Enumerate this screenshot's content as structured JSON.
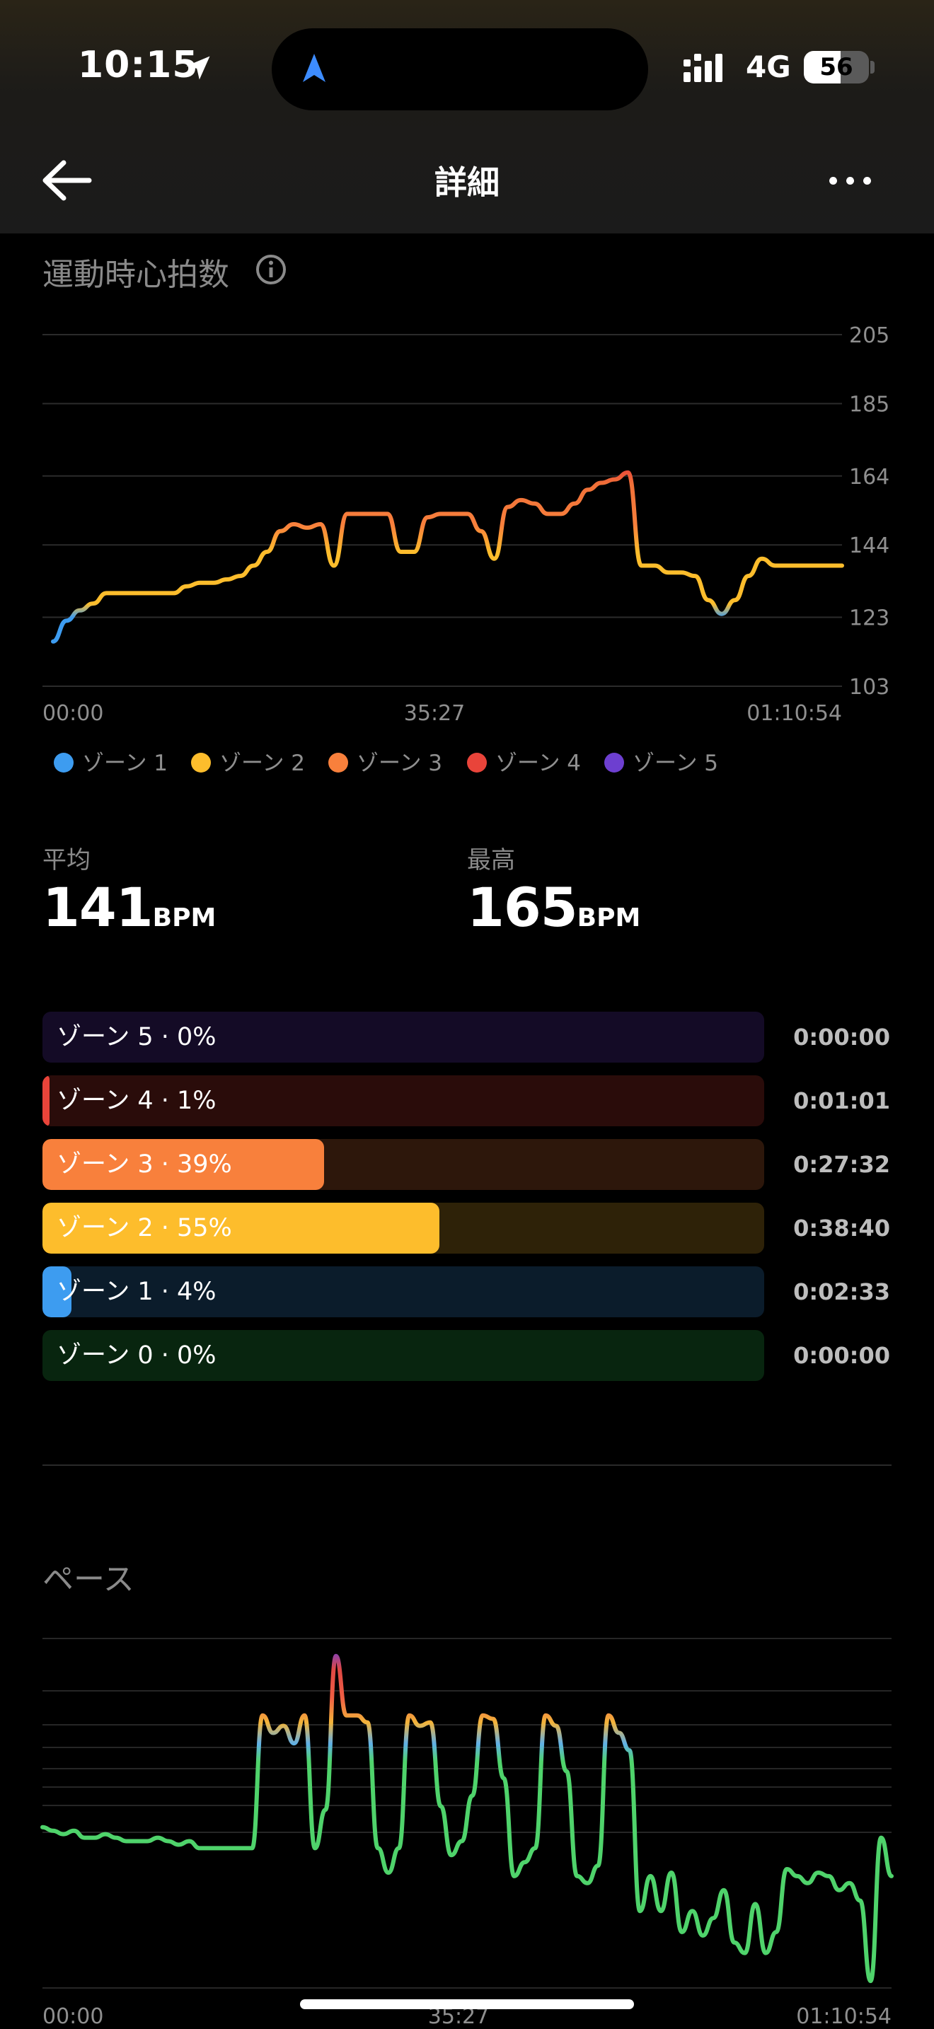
{
  "status_bar": {
    "time": "10:15",
    "network": "4G",
    "battery": "56"
  },
  "header": {
    "title": "詳細"
  },
  "hr_section": {
    "title": "運動時心拍数"
  },
  "chart_data": [
    {
      "type": "line",
      "title": "運動時心拍数",
      "x": [
        "00:00",
        "01:26",
        "02:53",
        "04:19",
        "05:45",
        "07:12",
        "08:38",
        "10:04",
        "11:31",
        "12:57",
        "14:24",
        "15:50",
        "17:16",
        "18:43",
        "20:09",
        "21:35",
        "23:02",
        "24:28",
        "25:55",
        "27:21",
        "28:47",
        "30:14",
        "31:40",
        "33:06",
        "34:33",
        "35:59",
        "37:26",
        "38:52",
        "40:18",
        "41:45",
        "43:11",
        "44:37",
        "46:04",
        "47:30",
        "48:57",
        "50:23",
        "51:49",
        "53:16",
        "54:42",
        "56:08",
        "57:35",
        "59:01",
        "01:00:28",
        "01:01:54",
        "01:03:20",
        "01:04:47",
        "01:06:13",
        "01:07:39",
        "01:09:06",
        "01:10:32"
      ],
      "series": [
        {
          "values": [
            116,
            122,
            125,
            127,
            130,
            130,
            130,
            130,
            130,
            130,
            132,
            133,
            133,
            134,
            135,
            138,
            142,
            148,
            150,
            149,
            150,
            138,
            153,
            153,
            153,
            153,
            142,
            142,
            152,
            153,
            153,
            153,
            148,
            140,
            155,
            157,
            156,
            153,
            153,
            156,
            160,
            162,
            163,
            165,
            138,
            138,
            136,
            136,
            135,
            128,
            124,
            128,
            135,
            140,
            138,
            138,
            138,
            138,
            138,
            138
          ]
        }
      ],
      "x_ticks": [
        "00:00",
        "35:27",
        "01:10:54"
      ],
      "y_ticks": [
        205,
        185,
        164,
        144,
        123,
        103
      ],
      "ylim": [
        103,
        205
      ],
      "legend": [
        "ゾーン 1",
        "ゾーン 2",
        "ゾーン 3",
        "ゾーン 4",
        "ゾーン 5"
      ],
      "legend_position": "bottom",
      "colors": [
        "#3d9cf0",
        "#fdbd2c",
        "#f8803c",
        "#e9443a",
        "#6d3fd0"
      ],
      "grid": true
    },
    {
      "type": "line",
      "title": "ペース",
      "x_ticks": [
        "00:00",
        "35:27",
        "01:10:54"
      ],
      "series": [
        {
          "values": [
            0.46,
            0.45,
            0.44,
            0.45,
            0.43,
            0.43,
            0.44,
            0.43,
            0.42,
            0.42,
            0.42,
            0.43,
            0.42,
            0.41,
            0.42,
            0.4,
            0.4,
            0.4,
            0.4,
            0.4,
            0.4,
            0.78,
            0.73,
            0.75,
            0.7,
            0.78,
            0.4,
            0.51,
            0.95,
            0.78,
            0.78,
            0.76,
            0.4,
            0.33,
            0.4,
            0.78,
            0.75,
            0.76,
            0.52,
            0.38,
            0.42,
            0.55,
            0.78,
            0.77,
            0.6,
            0.32,
            0.36,
            0.4,
            0.78,
            0.75,
            0.62,
            0.32,
            0.3,
            0.35,
            0.78,
            0.73,
            0.68,
            0.22,
            0.32,
            0.22,
            0.33,
            0.16,
            0.22,
            0.15,
            0.2,
            0.28,
            0.13,
            0.1,
            0.24,
            0.1,
            0.16,
            0.34,
            0.32,
            0.3,
            0.33,
            0.32,
            0.28,
            0.3,
            0.25,
            0.02,
            0.43,
            0.32
          ]
        }
      ],
      "grid": true
    }
  ],
  "stats": {
    "avg_label": "平均",
    "avg_value": "141",
    "avg_unit": "BPM",
    "max_label": "最高",
    "max_value": "165",
    "max_unit": "BPM"
  },
  "zones": [
    {
      "label": "ゾーン 5 · 0%",
      "time": "0:00:00",
      "percent": 0,
      "color": "#6d3fd0"
    },
    {
      "label": "ゾーン 4 · 1%",
      "time": "0:01:01",
      "percent": 1,
      "color": "#e9443a"
    },
    {
      "label": "ゾーン 3 · 39%",
      "time": "0:27:32",
      "percent": 39,
      "color": "#f8803c"
    },
    {
      "label": "ゾーン 2 · 55%",
      "time": "0:38:40",
      "percent": 55,
      "color": "#fdbd2c"
    },
    {
      "label": "ゾーン 1 · 4%",
      "time": "0:02:33",
      "percent": 4,
      "color": "#3d9cf0"
    },
    {
      "label": "ゾーン 0 · 0%",
      "time": "0:00:00",
      "percent": 0,
      "color": "#2ecc55"
    }
  ],
  "pace_section": {
    "title": "ペース"
  }
}
